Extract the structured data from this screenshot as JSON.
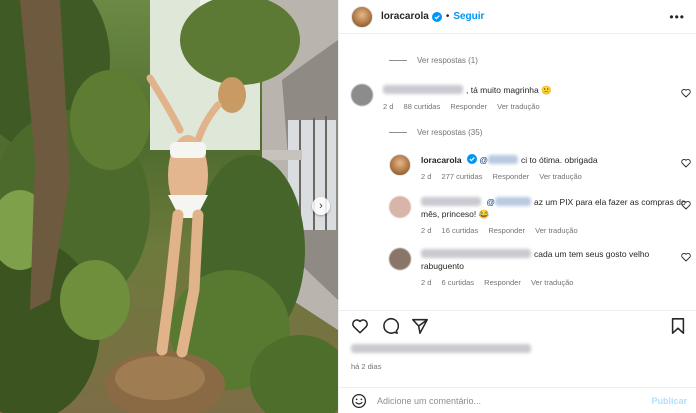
{
  "header": {
    "username": "loracarola",
    "separator": "•",
    "follow_label": "Seguir",
    "more_label": "•••"
  },
  "comments": {
    "view_replies_1": "Ver respostas (1)",
    "comment_1": {
      "text": ", tá muito magrinha 😕",
      "time": "2 d",
      "likes": "88 curtidas",
      "reply": "Responder",
      "translate": "Ver tradução"
    },
    "view_replies_2": "Ver respostas (35)",
    "reply_1": {
      "username": "loracarola",
      "mention": "@",
      "text": "ci to ótima. obrigada",
      "time": "2 d",
      "likes": "277 curtidas",
      "reply": "Responder",
      "translate": "Ver tradução"
    },
    "reply_2": {
      "mention": "@",
      "text": "az um PIX para ela fazer as compras do mês, princeso! 😂",
      "time": "2 d",
      "likes": "16 curtidas",
      "reply": "Responder",
      "translate": "Ver tradução"
    },
    "reply_3": {
      "text": "cada um tem seus gosto velho rabuguento",
      "time": "2 d",
      "likes": "6 curtidas",
      "reply": "Responder",
      "translate": "Ver tradução"
    }
  },
  "footer": {
    "time_ago": "há 2 dias",
    "add_comment_placeholder": "Adicione um comentário...",
    "publish_label": "Publicar"
  },
  "icons": [
    "chevron-right-icon",
    "verified-badge-icon",
    "heart-icon",
    "comment-icon",
    "share-icon",
    "bookmark-icon",
    "emoji-icon"
  ],
  "colors": {
    "accent": "#0095f6",
    "publish_disabled": "#b2dffc",
    "muted": "#737373"
  }
}
